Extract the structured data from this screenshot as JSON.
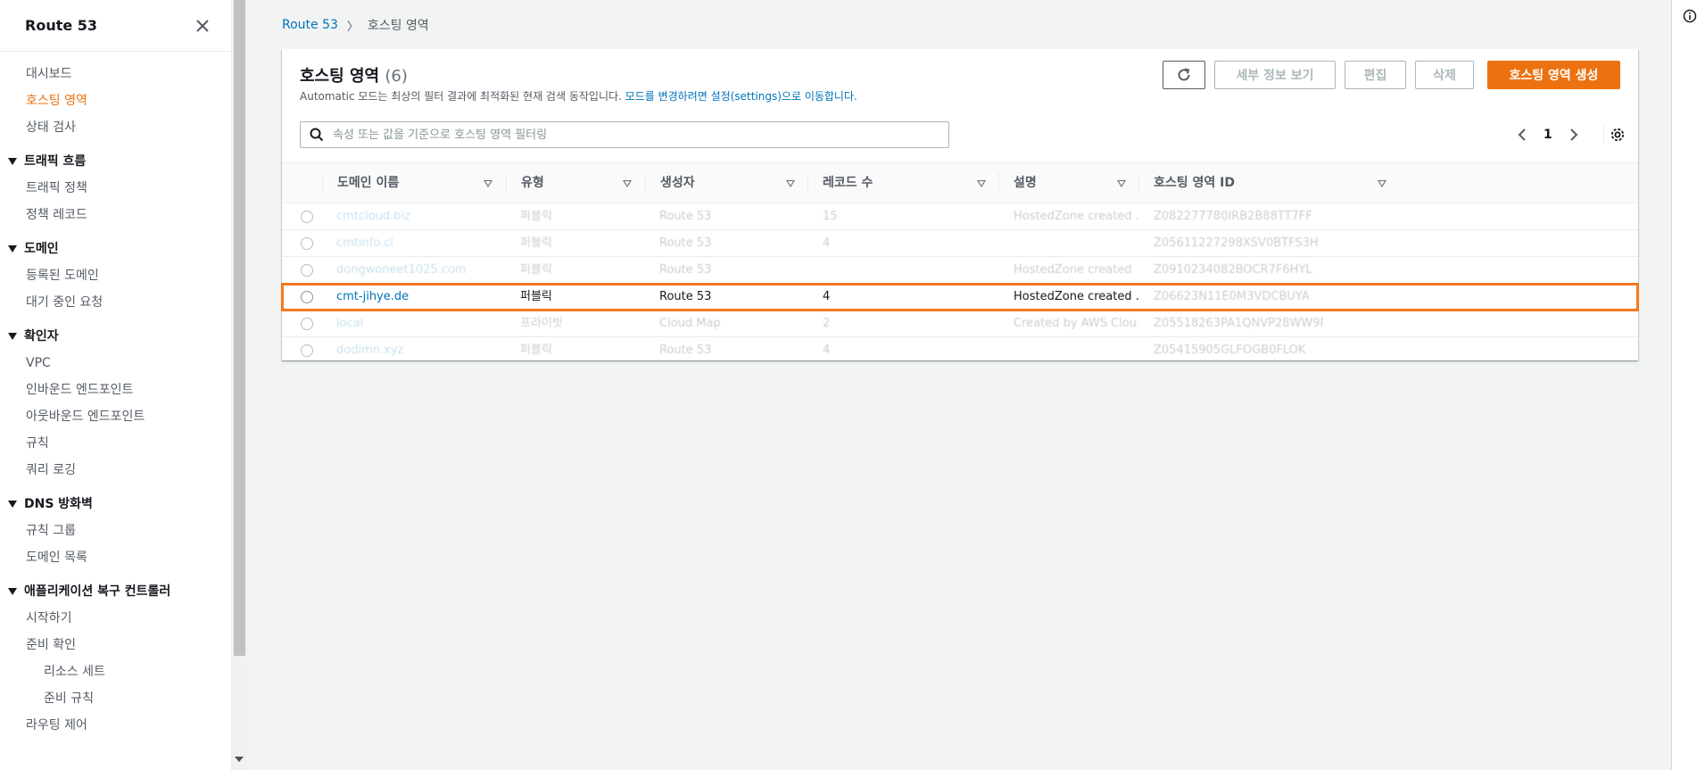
{
  "sidebar": {
    "title": "Route 53",
    "items": [
      {
        "type": "item",
        "label": "대시보드"
      },
      {
        "type": "item",
        "label": "호스팅 영역",
        "active": true
      },
      {
        "type": "item",
        "label": "상태 검사"
      },
      {
        "type": "section",
        "label": "트래픽 흐름"
      },
      {
        "type": "item",
        "label": "트래픽 정책"
      },
      {
        "type": "item",
        "label": "정책 레코드"
      },
      {
        "type": "section",
        "label": "도메인"
      },
      {
        "type": "item",
        "label": "등록된 도메인"
      },
      {
        "type": "item",
        "label": "대기 중인 요청"
      },
      {
        "type": "section",
        "label": "확인자"
      },
      {
        "type": "item",
        "label": "VPC"
      },
      {
        "type": "item",
        "label": "인바운드 엔드포인트"
      },
      {
        "type": "item",
        "label": "아웃바운드 엔드포인트"
      },
      {
        "type": "item",
        "label": "규칙"
      },
      {
        "type": "item",
        "label": "쿼리 로깅"
      },
      {
        "type": "section",
        "label": "DNS 방화벽"
      },
      {
        "type": "item",
        "label": "규칙 그룹"
      },
      {
        "type": "item",
        "label": "도메인 목록"
      },
      {
        "type": "section",
        "label": "애플리케이션 복구 컨트롤러"
      },
      {
        "type": "item",
        "label": "시작하기"
      },
      {
        "type": "item",
        "label": "준비 확인"
      },
      {
        "type": "sub",
        "label": "리소스 세트"
      },
      {
        "type": "sub",
        "label": "준비 규칙"
      },
      {
        "type": "item",
        "label": "라우팅 제어"
      }
    ]
  },
  "breadcrumb": {
    "root": "Route 53",
    "sep": "〉",
    "current": "호스팅 영역"
  },
  "panel": {
    "title": "호스팅 영역",
    "count": "(6)",
    "desc_prefix": "Automatic 모드는 최상의 필터 결과에 최적화된 현재 검색 동작입니다.",
    "desc_link": "모드를 변경하려면 설정(settings)으로 이동합니다."
  },
  "buttons": {
    "details": "세부 정보 보기",
    "edit": "편집",
    "delete": "삭제",
    "create": "호스팅 영역 생성"
  },
  "search": {
    "placeholder": "속성 또는 값을 기준으로 호스팅 영역 필터링"
  },
  "pagination": {
    "page": "1"
  },
  "table": {
    "columns": [
      "도메인 이름",
      "유형",
      "생성자",
      "레코드 수",
      "설명",
      "호스팅 영역 ID"
    ],
    "rows": [
      {
        "domain": "cmtcloud.biz",
        "type": "퍼블릭",
        "created_by": "Route 53",
        "records": "15",
        "description": "HostedZone created ...",
        "zone_id": "Z082277780IRB2B88TT7FF",
        "dim": true
      },
      {
        "domain": "cmtinfo.cl",
        "type": "퍼블릭",
        "created_by": "Route 53",
        "records": "4",
        "description": "",
        "zone_id": "Z05611227298XSV0BTFS3H",
        "dim": true
      },
      {
        "domain": "dongwoneet1025.com",
        "type": "퍼블릭",
        "created_by": "Route 53",
        "records": "",
        "description": "HostedZone created",
        "zone_id": "Z0910234082BOCR7F6HYL",
        "dim": true
      },
      {
        "domain": "cmt-jihye.de",
        "type": "퍼블릭",
        "created_by": "Route 53",
        "records": "4",
        "description": "HostedZone created ...",
        "zone_id": "Z06623N11E0M3VDCBUYA",
        "highlight": true
      },
      {
        "domain": "local",
        "type": "프라이빗",
        "created_by": "Cloud Map",
        "records": "2",
        "description": "Created by AWS Clou...",
        "zone_id": "Z05518263PA1QNVP28WW9P",
        "dim": true
      },
      {
        "domain": "dodimn.xyz",
        "type": "퍼블릭",
        "created_by": "Route 53",
        "records": "4",
        "description": "",
        "zone_id": "Z05415905GLFOGB0FLOK",
        "dim": true
      }
    ]
  },
  "colors": {
    "accent": "#ec7211",
    "link": "#0073bb",
    "highlight_border": "#f07b23"
  }
}
